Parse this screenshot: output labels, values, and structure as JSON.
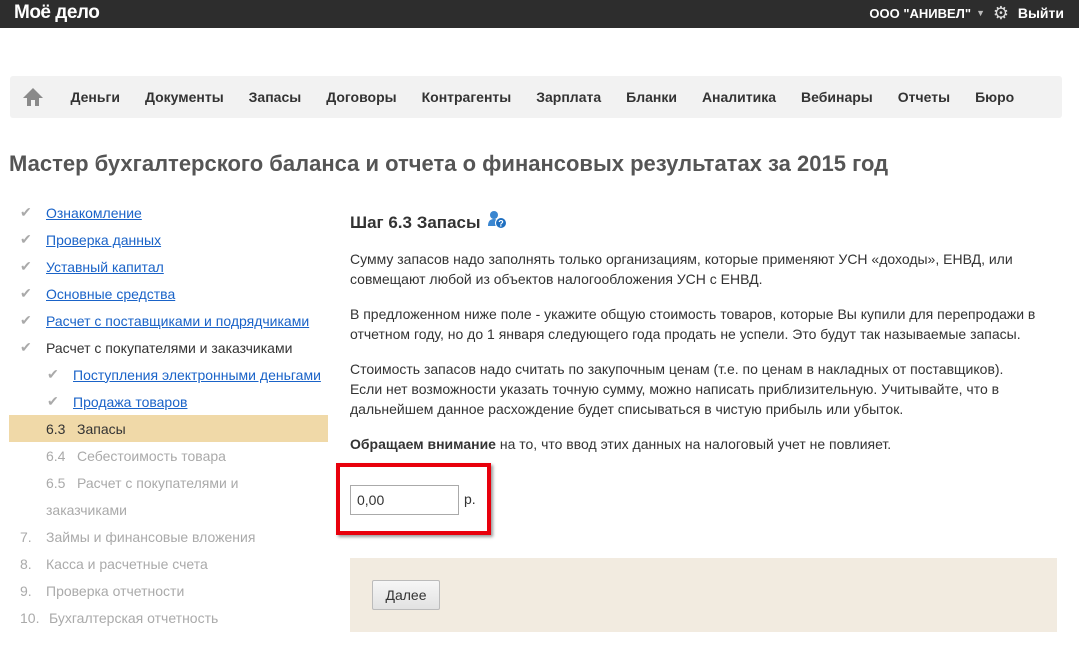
{
  "topbar": {
    "logo": "Моё дело",
    "org": "ООО \"АНИВЕЛ\"",
    "logout": "Выйти"
  },
  "nav": [
    "Деньги",
    "Документы",
    "Запасы",
    "Договоры",
    "Контрагенты",
    "Зарплата",
    "Бланки",
    "Аналитика",
    "Вебинары",
    "Отчеты",
    "Бюро"
  ],
  "title": "Мастер бухгалтерского баланса и отчета о финансовых результатах за 2015 год",
  "sidebar": [
    {
      "label": "Ознакомление"
    },
    {
      "label": "Проверка данных"
    },
    {
      "label": "Уставный капитал"
    },
    {
      "label": "Основные средства"
    },
    {
      "label": "Расчет с поставщиками и подрядчиками"
    },
    {
      "label": "Расчет с покупателями и заказчиками"
    },
    {
      "label": "Поступления электронными деньгами"
    },
    {
      "label": "Продажа товаров"
    },
    {
      "num": "6.3",
      "label": "Запасы"
    },
    {
      "num": "6.4",
      "label": "Себестоимость товара"
    },
    {
      "num": "6.5",
      "label": "Расчет с покупателями и",
      "label2": "заказчиками"
    },
    {
      "num": "7.",
      "label": "Займы и финансовые вложения"
    },
    {
      "num": "8.",
      "label": "Касса и расчетные счета"
    },
    {
      "num": "9.",
      "label": "Проверка отчетности"
    },
    {
      "num": "10.",
      "label": "Бухгалтерская отчетность"
    }
  ],
  "main": {
    "step": "Шаг 6.3 Запасы",
    "p1": "Сумму запасов надо заполнять только организациям, которые применяют УСН «доходы», ЕНВД, или совмещают любой из объектов налогообложения УСН с ЕНВД.",
    "p2": "В предложенном ниже поле - укажите общую стоимость товаров, которые Вы купили для перепродажи в отчетном году, но до 1 января следующего года продать не успели. Это будут так называемые запасы.",
    "p3a": "Стоимость запасов надо считать по закупочным ценам (т.е. по ценам в накладных от поставщиков).",
    "p3b": "Если нет возможности указать точную сумму, можно написать приблизительную. Учитывайте, что в дальнейшем данное расхождение будет списываться в чистую прибыль или убыток.",
    "p4bold": "Обращаем внимание",
    "p4": " на то, что ввод этих данных на налоговый учет не повлияет.",
    "value": "0,00",
    "currency": "р.",
    "next": "Далее"
  }
}
